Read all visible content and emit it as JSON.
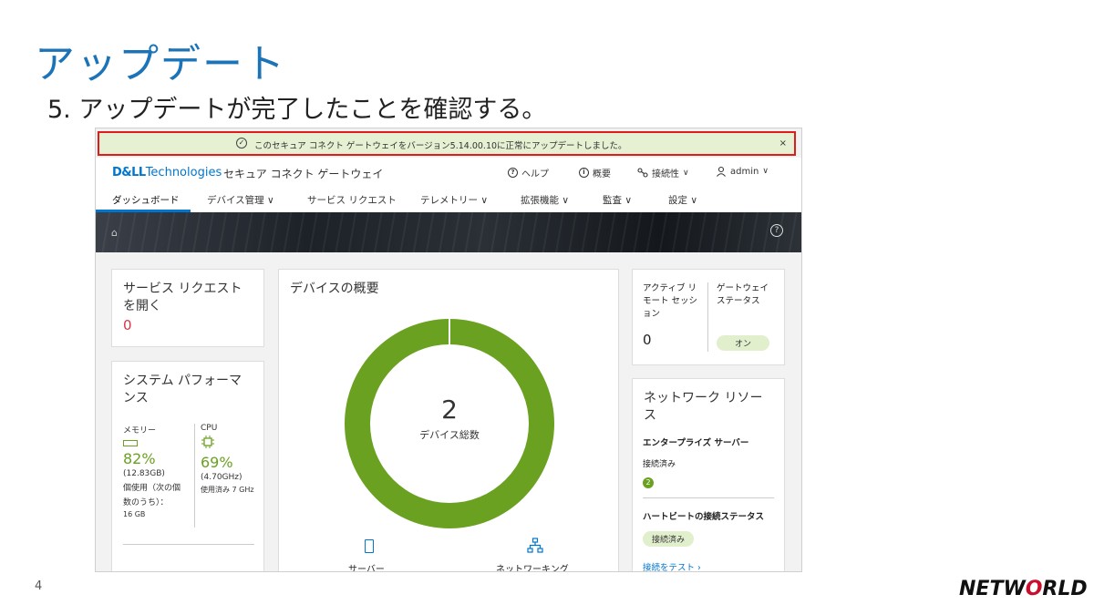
{
  "slide": {
    "title": "アップデート",
    "step": "5.  アップデートが完了したことを確認する。",
    "page_number": "4",
    "logo_prefix": "NETW",
    "logo_o": "O",
    "logo_suffix": "RLD"
  },
  "banner": {
    "message": "このセキュア コネクト ゲートウェイをバージョン5.14.00.10に正常にアップデートしました。",
    "close": "×"
  },
  "header": {
    "brand_bold": "D&LL",
    "brand_rest": "Technologies",
    "app_name": "セキュア コネクト ゲートウェイ",
    "help": "ヘルプ",
    "overview": "概要",
    "connectivity": "接続性",
    "user": "admin"
  },
  "menu": {
    "dashboard": "ダッシュボード",
    "devices": "デバイス管理",
    "service_requests": "サービス リクエスト",
    "telemetry": "テレメトリー",
    "extensions": "拡張機能",
    "audit": "監査",
    "settings": "設定"
  },
  "cards": {
    "open_sr": {
      "title_line1": "サービス リクエスト",
      "title_line2": "を開く",
      "value": "0"
    },
    "perf": {
      "title_line1": "システム パフォーマ",
      "title_line2": "ンス",
      "memory_label": "メモリー",
      "memory_pct": "82%",
      "memory_detail1": "(12.83GB)",
      "memory_detail2": "個使用（次の個",
      "memory_detail3": "数のうち）：",
      "memory_detail4": "16 GB",
      "cpu_label": "CPU",
      "cpu_pct": "69%",
      "cpu_detail1": "(4.70GHz)",
      "cpu_detail2": "使用済み 7 GHz"
    },
    "devices": {
      "title": "デバイスの概要",
      "total": "2",
      "total_label": "デバイス総数",
      "server_label": "サーバー",
      "network_label": "ネットワーキング"
    },
    "remote": {
      "active_line1": "アクティブ リ",
      "active_line2": "モート セッシ",
      "active_line3": "ョン",
      "active_value": "0",
      "gw_line1": "ゲートウェイ",
      "gw_line2": "ステータス",
      "gw_status": "オン"
    },
    "network": {
      "title_line1": "ネットワーク リソー",
      "title_line2": "ス",
      "enterprise": "エンタープライズ サーバー",
      "connected": "接続済み",
      "connected_count": "2",
      "heartbeat": "ハートビートの接続ステータス",
      "heartbeat_status": "接続済み",
      "test_link": "接続をテスト"
    }
  },
  "colors": {
    "accent": "#0076ce",
    "success": "#6aa121",
    "alert": "#e11b1b",
    "title": "#1b74b8"
  }
}
